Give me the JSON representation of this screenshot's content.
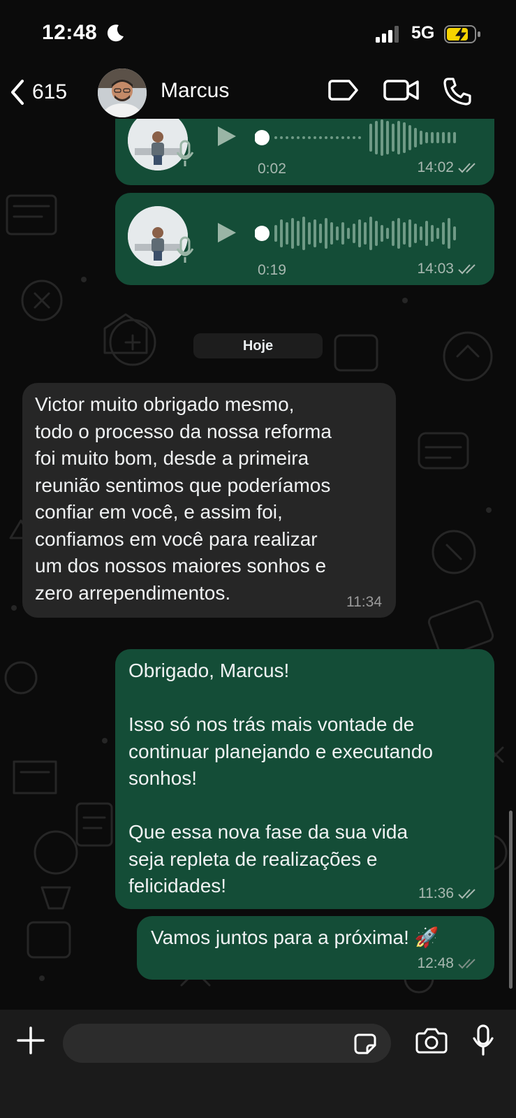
{
  "status_bar": {
    "time": "12:48",
    "network": "5G"
  },
  "header": {
    "back_count": "615",
    "contact_name": "Marcus"
  },
  "messages": [
    {
      "type": "voice",
      "direction": "out",
      "duration": "0:02",
      "time": "14:02",
      "status": "read"
    },
    {
      "type": "voice",
      "direction": "out",
      "duration": "0:19",
      "time": "14:03",
      "status": "read"
    },
    {
      "type": "date",
      "label": "Hoje"
    },
    {
      "type": "text",
      "direction": "in",
      "text": "Victor muito obrigado mesmo,\ntodo o processo da nossa reforma\nfoi muito bom, desde a primeira\nreunião sentimos que poderíamos\nconfiar em você, e assim foi,\nconfiamos em você para realizar\num dos nossos maiores sonhos e\nzero arrependimentos.",
      "time": "11:34"
    },
    {
      "type": "text",
      "direction": "out",
      "text": "Obrigado, Marcus!\n\nIsso só nos trás mais vontade de\ncontinuar planejando e executando\nsonhos!\n\nQue essa nova fase da sua vida\nseja repleta de realizações e\nfelicidades!",
      "time": "11:36",
      "status": "read"
    },
    {
      "type": "text",
      "direction": "out",
      "text": "Vamos juntos para a próxima! 🚀",
      "time": "12:48",
      "status": "delivered"
    }
  ],
  "colors": {
    "outgoing_bubble": "#144d37",
    "incoming_bubble": "#262626",
    "read_tick": "#a8b8b0"
  },
  "icons": [
    "chevron-left-icon",
    "label-tag-icon",
    "video-call-icon",
    "phone-icon",
    "play-icon",
    "mic-icon",
    "plus-icon",
    "sticker-icon",
    "camera-icon",
    "microphone-icon"
  ]
}
